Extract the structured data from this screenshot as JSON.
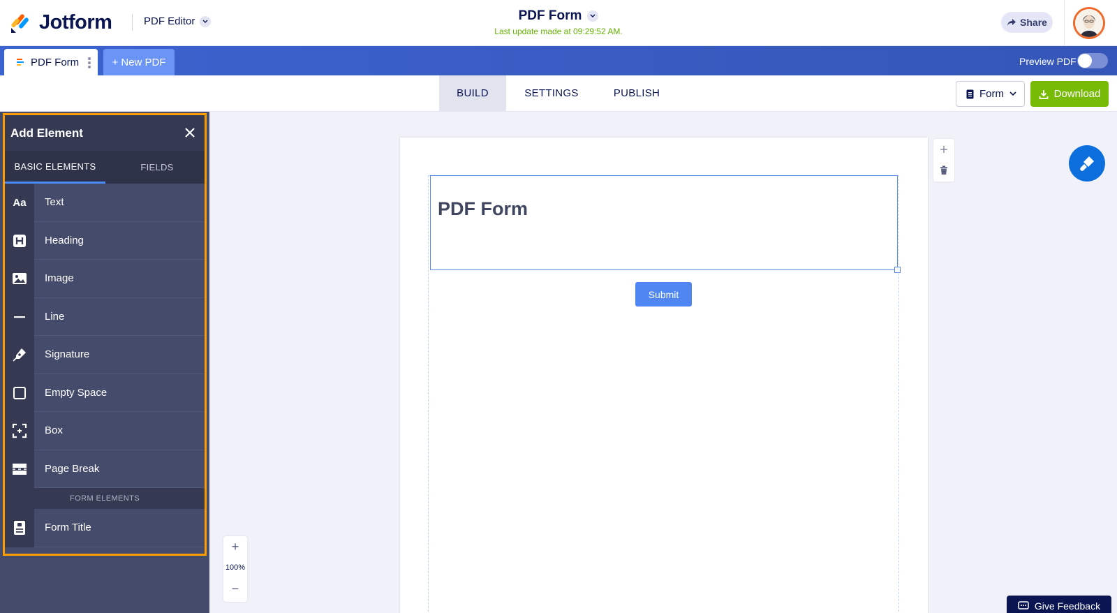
{
  "header": {
    "logo_text": "Jotform",
    "app_switch_label": "PDF Editor",
    "doc_title": "PDF Form",
    "last_update": "Last update made at 09:29:52 AM.",
    "share_label": "Share",
    "avatar_icon": "user-avatar"
  },
  "tabbar": {
    "doc_tab_label": "PDF Form",
    "new_pdf_label": "+ New PDF",
    "preview_label": "Preview PDF",
    "preview_enabled": false
  },
  "subnav": {
    "tabs": [
      {
        "label": "BUILD",
        "active": true
      },
      {
        "label": "SETTINGS",
        "active": false
      },
      {
        "label": "PUBLISH",
        "active": false
      }
    ],
    "form_select_value": "Form",
    "download_label": "Download"
  },
  "panel": {
    "title": "Add Element",
    "tabs": [
      {
        "label": "BASIC ELEMENTS",
        "active": true
      },
      {
        "label": "FIELDS",
        "active": false
      }
    ],
    "basic_elements": [
      {
        "label": "Text",
        "icon": "text-aa-icon"
      },
      {
        "label": "Heading",
        "icon": "heading-icon"
      },
      {
        "label": "Image",
        "icon": "image-icon"
      },
      {
        "label": "Line",
        "icon": "line-icon"
      },
      {
        "label": "Signature",
        "icon": "signature-pen-icon"
      },
      {
        "label": "Empty Space",
        "icon": "empty-space-icon"
      },
      {
        "label": "Box",
        "icon": "box-icon"
      },
      {
        "label": "Page Break",
        "icon": "page-break-icon"
      }
    ],
    "form_section_title": "FORM ELEMENTS",
    "form_elements": [
      {
        "label": "Form Title",
        "icon": "form-title-icon"
      }
    ]
  },
  "canvas": {
    "form_title": "PDF Form",
    "submit_label": "Submit"
  },
  "zoom": {
    "value": "100%",
    "plus": "+",
    "minus": "−"
  },
  "feedback_label": "Give Feedback",
  "colors": {
    "accent_blue": "#3d63cf",
    "download_green": "#78bb07",
    "panel_bg": "#454b6a",
    "highlight_orange": "#ff9d00"
  }
}
